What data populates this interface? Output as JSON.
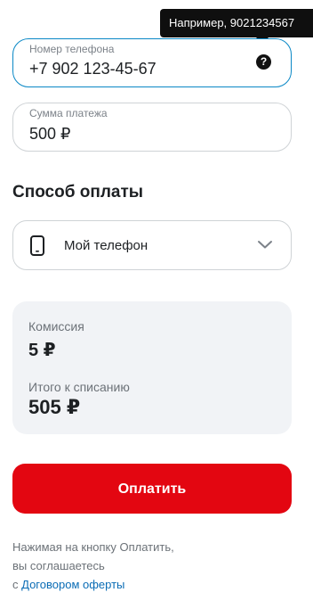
{
  "tooltip": {
    "text": "Например, 9021234567"
  },
  "phone_field": {
    "label": "Номер телефона",
    "value": "+7 902 123-45-67",
    "help_icon": "?"
  },
  "sum_field": {
    "label": "Сумма платежа",
    "value": "500 ₽"
  },
  "payment_method": {
    "title": "Способ оплаты",
    "selected": "Мой телефон",
    "icon": "smartphone-icon"
  },
  "summary": {
    "commission_label": "Комиссия",
    "commission_value": "5 ₽",
    "total_label": "Итого к списанию",
    "total_value": "505 ₽"
  },
  "pay_button": {
    "label": "Оплатить"
  },
  "agreement": {
    "line1": "Нажимая на кнопку Оплатить,",
    "line2": "вы соглашаетесь",
    "prefix": "с",
    "link": "Договором оферты"
  },
  "colors": {
    "accent_red": "#e30611",
    "focus_blue": "#0a88c6",
    "link_blue": "#0a6cb5",
    "summary_bg": "#f1f3f6"
  }
}
